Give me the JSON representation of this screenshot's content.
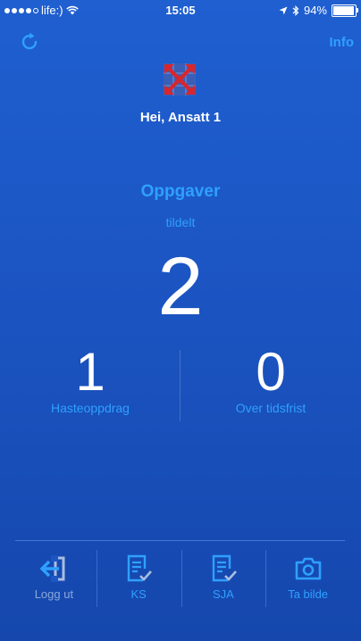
{
  "status_bar": {
    "carrier": "life:)",
    "time": "15:05",
    "battery": "94%",
    "battery_level": 0.94
  },
  "header": {
    "info_label": "Info"
  },
  "greeting": "Hei, Ansatt 1",
  "tasks": {
    "title": "Oppgaver",
    "subtitle": "tildelt",
    "count": "2"
  },
  "stats": [
    {
      "value": "1",
      "label": "Hasteoppdrag"
    },
    {
      "value": "0",
      "label": "Over tidsfrist"
    }
  ],
  "tabbar": [
    {
      "label": "Logg ut",
      "icon": "logout-icon"
    },
    {
      "label": "KS",
      "icon": "checklist-icon"
    },
    {
      "label": "SJA",
      "icon": "checklist-icon"
    },
    {
      "label": "Ta bilde",
      "icon": "camera-icon"
    }
  ],
  "colors": {
    "accent": "#2fa0ff",
    "background": "#1c56c4",
    "logo_red": "#d9262c"
  }
}
